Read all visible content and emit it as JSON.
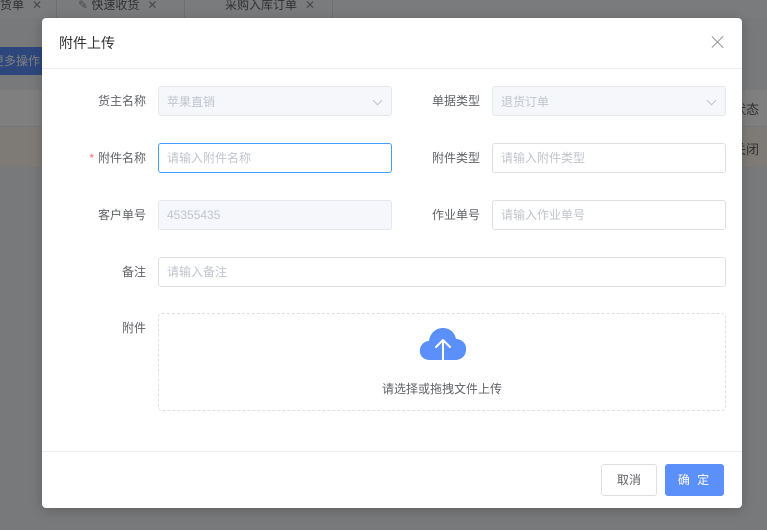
{
  "background": {
    "tabs": [
      {
        "label": "货单"
      },
      {
        "label": "快速收货"
      },
      {
        "label": "采购入库订单"
      }
    ],
    "more_button": "更多操作",
    "col_status": "状态",
    "row_status": "关闭"
  },
  "dialog": {
    "title": "附件上传",
    "fields": {
      "owner": {
        "label": "货主名称",
        "value": "苹果直销"
      },
      "doc_type": {
        "label": "单据类型",
        "value": "退货订单"
      },
      "attachment_name": {
        "label": "附件名称",
        "placeholder": "请输入附件名称"
      },
      "attachment_type": {
        "label": "附件类型",
        "placeholder": "请输入附件类型"
      },
      "customer_no": {
        "label": "客户单号",
        "value": "45355435"
      },
      "work_no": {
        "label": "作业单号",
        "placeholder": "请输入作业单号"
      },
      "remark": {
        "label": "备注",
        "placeholder": "请输入备注"
      },
      "attachment": {
        "label": "附件"
      }
    },
    "upload_hint": "请选择或拖拽文件上传",
    "cancel_label": "取消",
    "ok_label": "确 定",
    "accent_color": "#5b8ff9"
  }
}
